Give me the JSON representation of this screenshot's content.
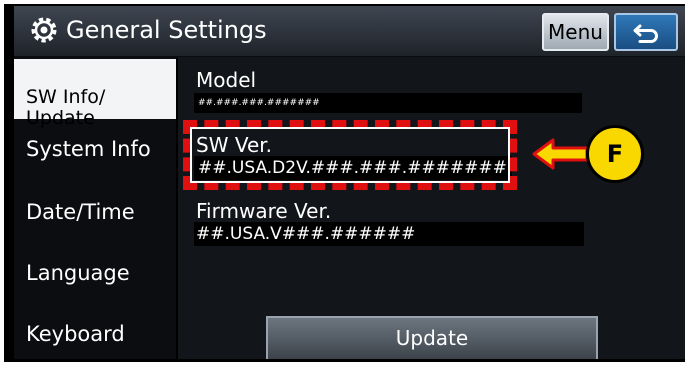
{
  "header": {
    "title": "General Settings",
    "menu_label": "Menu",
    "icons": {
      "settings": "gear-icon",
      "back": "back-arrow-icon"
    }
  },
  "sidebar": {
    "items": [
      {
        "label": "SW Info/\nUpdate",
        "active": true
      },
      {
        "label": "System Info",
        "active": false
      },
      {
        "label": "Date/Time",
        "active": false
      },
      {
        "label": "Language",
        "active": false
      },
      {
        "label": "Keyboard",
        "active": false
      }
    ]
  },
  "info": {
    "model_label": "Model",
    "model_value": "##.###.###.#######",
    "sw_label": "SW Ver.",
    "sw_value": "##.USA.D2V.###.###.#######",
    "fw_label": "Firmware Ver.",
    "fw_value": "##.USA.V###.######"
  },
  "update_label": "Update",
  "callout": {
    "label": "F",
    "color": "#f9d800",
    "highlight_color": "#e01010"
  }
}
